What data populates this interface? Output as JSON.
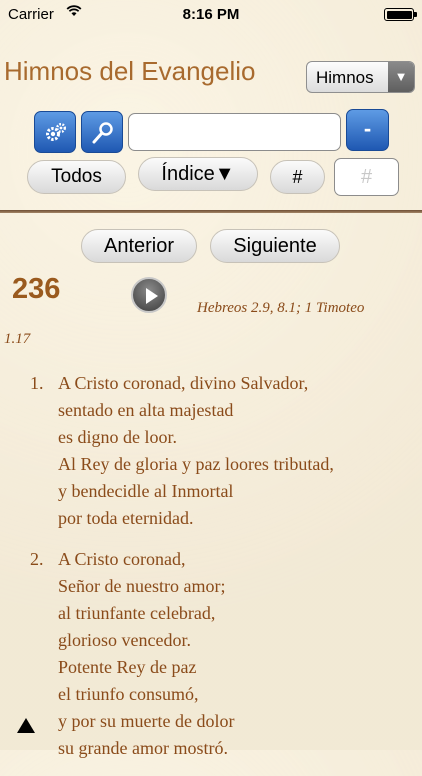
{
  "status": {
    "carrier": "Carrier",
    "time": "8:16 PM"
  },
  "header": {
    "title": "Himnos del Evangelio",
    "select_value": "Himnos"
  },
  "toolbar": {
    "minus_label": "-",
    "all_label": "Todos",
    "index_label": "Índice▼",
    "hash_label": "#",
    "number_placeholder": "#",
    "search_value": ""
  },
  "nav": {
    "prev_label": "Anterior",
    "next_label": "Siguiente"
  },
  "hymn": {
    "number": "236",
    "references_line1": "Hebreos 2.9, 8.1; 1 Timoteo",
    "references_line2": "1.17",
    "verses": [
      {
        "number": "1.",
        "lines": [
          "A Cristo coronad, divino Salvador,",
          "sentado en alta majestad",
          "es digno de loor.",
          "Al Rey de gloria y paz loores tributad,",
          "y bendecidle al Inmortal",
          "por toda eternidad."
        ]
      },
      {
        "number": "2.",
        "lines": [
          "A Cristo coronad,",
          "Señor de nuestro amor;",
          "al triunfante celebrad,",
          "glorioso vencedor.",
          "Potente Rey de paz",
          "el triunfo consumó,",
          "y por su muerte de dolor",
          "su grande amor mostró."
        ]
      }
    ]
  },
  "icons": [
    "wifi-icon",
    "battery-icon",
    "settings-gear-icon",
    "search-icon",
    "play-icon",
    "scroll-up-icon"
  ]
}
